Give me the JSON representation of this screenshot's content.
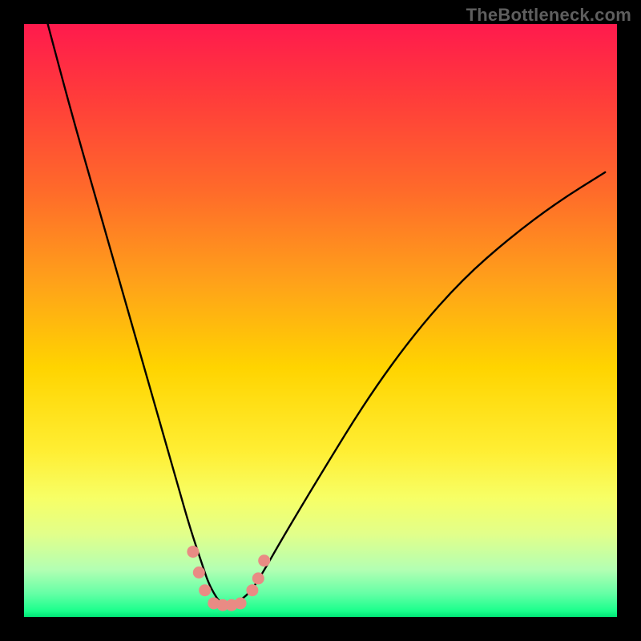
{
  "watermark": "TheBottleneck.com",
  "chart_data": {
    "type": "line",
    "title": "",
    "xlabel": "",
    "ylabel": "",
    "xlim": [
      0,
      100
    ],
    "ylim": [
      0,
      100
    ],
    "grid": false,
    "annotations": [],
    "series": [
      {
        "name": "bottleneck-curve",
        "x": [
          4,
          8,
          12,
          16,
          20,
          22,
          24,
          26,
          28,
          30,
          31,
          32,
          33,
          34,
          35,
          36,
          38,
          40,
          44,
          50,
          58,
          66,
          74,
          82,
          90,
          98
        ],
        "y": [
          100,
          85,
          71,
          57,
          43,
          36,
          29,
          22,
          15,
          9,
          6,
          4,
          2.5,
          2,
          2,
          2.5,
          4,
          7,
          14,
          24,
          37,
          48,
          57,
          64,
          70,
          75
        ]
      }
    ],
    "markers": {
      "name": "highlight-dots",
      "color": "#e98b84",
      "points": [
        {
          "x": 28.5,
          "y": 11
        },
        {
          "x": 29.5,
          "y": 7.5
        },
        {
          "x": 30.5,
          "y": 4.5
        },
        {
          "x": 32.0,
          "y": 2.3
        },
        {
          "x": 33.5,
          "y": 2.0
        },
        {
          "x": 35.0,
          "y": 2.0
        },
        {
          "x": 36.5,
          "y": 2.3
        },
        {
          "x": 38.5,
          "y": 4.5
        },
        {
          "x": 39.5,
          "y": 6.5
        },
        {
          "x": 40.5,
          "y": 9.5
        }
      ]
    },
    "background_gradient": {
      "top": "#ff1a4d",
      "mid1": "#ffd400",
      "mid2": "#f7ff66",
      "bottom": "#00e676"
    }
  }
}
